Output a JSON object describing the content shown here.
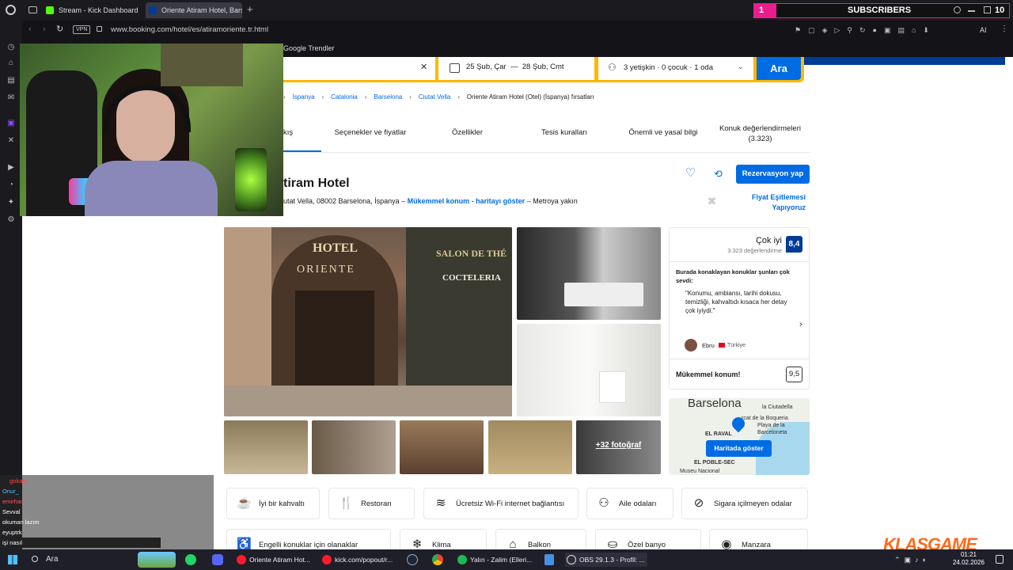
{
  "browser": {
    "tabs": [
      {
        "label": "Stream - Kick Dashboard"
      },
      {
        "label": "Oriente Atiram Hotel, Barse"
      }
    ],
    "url": "www.booking.com/hotel/es/atiramoriente.tr.html",
    "vpn_label": "VPN",
    "bookmark_label": "Google Trendler",
    "ai_label": "AI"
  },
  "subscribers_widget": {
    "count": "1",
    "label": "SUBSCRIBERS",
    "right_number": "10"
  },
  "search": {
    "dates": "25 Şub, Çar  —  28 Şub, Cmt",
    "guests": "3 yetişkin · 0 çocuk · 1 oda",
    "search_button": "Ara"
  },
  "breadcrumb": [
    "İspanya",
    "Catalonia",
    "Barselona",
    "Ciutat Vella",
    "Oriente Atiram Hotel (Otel) (İspanya) fırsatları"
  ],
  "nav_tabs": [
    "kış",
    "Seçenekler ve fiyatlar",
    "Özellikler",
    "Tesis kuralları",
    "Önemli ve yasal bilgi",
    "Konuk değerlendirmeleri",
    "(3.323)"
  ],
  "hotel": {
    "name": "tiram Hotel",
    "address": "utat Vella, 08002 Barselona, İspanya –",
    "location_link": "Mükemmel konum - haritayı göster",
    "metro": "– Metroya yakın",
    "reserve_button": "Rezervasyon yap",
    "price_match_line1": "Fiyat Eşitlemesi",
    "price_match_line2": "Yapıyoruz",
    "photo_signs": {
      "hotel": "HOTEL",
      "oriente": "ORIENTE",
      "salon": "SALON DE THÉ",
      "cocteleria": "COCTELERIA"
    },
    "more_photos": "+32 fotoğraf"
  },
  "review": {
    "rating_word": "Çok iyi",
    "count": "3.323 değerlendirme",
    "score": "8,4",
    "intro": "Burada konaklayan konuklar şunları çok sevdi:",
    "quote": "\"Konumu, ambiansı, tarihi dokusu, temizliği, kahvaltıdı kısaca her detay çok iyiydi.\"",
    "reviewer": "Ebru",
    "country": "Türkiye",
    "location_label": "Mükemmel konum!",
    "location_score": "9,5"
  },
  "map": {
    "city": "Barselona",
    "labels": [
      "la Ciutadella",
      "rcat de la Boqueria",
      "Playa de la",
      "Barceloneta",
      "EL RAVAL",
      "EL POBLE-SEC",
      "Museu Nacional"
    ],
    "show_button": "Haritada göster"
  },
  "amenities": [
    {
      "label": "İyi bir kahvaltı",
      "icon": "coffee-icon"
    },
    {
      "label": "Restoran",
      "icon": "cutlery-icon"
    },
    {
      "label": "Ücretsiz Wi-Fi internet bağlantısı",
      "icon": "wifi-icon"
    },
    {
      "label": "Aile odaları",
      "icon": "family-icon"
    },
    {
      "label": "Sigara içilmeyen odalar",
      "icon": "no-smoking-icon"
    },
    {
      "label": "Engelli konuklar için olanaklar",
      "icon": "accessible-icon"
    },
    {
      "label": "Klima",
      "icon": "snowflake-icon"
    },
    {
      "label": "Balkon",
      "icon": "balcony-icon"
    },
    {
      "label": "Özel banyo",
      "icon": "bath-icon"
    },
    {
      "label": "Manzara",
      "icon": "eye-icon"
    }
  ],
  "chat": [
    {
      "user": "gokalp",
      "text": "",
      "color": "#e53935"
    },
    {
      "user": "Onur_",
      "text": "",
      "color": "#4fc3f7"
    },
    {
      "user": "emirhan",
      "text": "",
      "color": "#ff5252"
    },
    {
      "user": "Sevval",
      "text": "",
      "color": "#ffffff"
    },
    {
      "user": "okuman lazım",
      "text": "",
      "color": "#ffffff"
    },
    {
      "user": "eyuptrk",
      "text": "",
      "color": "#ffffff"
    },
    {
      "user": "işi nasıl",
      "text": "",
      "color": "#ffffff"
    }
  ],
  "taskbar": {
    "search_label": "Ara",
    "items": [
      "Oriente Atiram Hot...",
      "kick.com/popout/r...",
      "Yalın - Zalim (Elleri...",
      "OBS 29.1.3 - Profil: ..."
    ],
    "time": "01:21",
    "date": "24.02.2026"
  },
  "watermark": "KLASGAME",
  "colors": {
    "booking_blue": "#006ce4",
    "booking_dark": "#003b95",
    "yellow": "#ffb700",
    "kick_green": "#53fc18",
    "magenta": "#e91e8c"
  }
}
